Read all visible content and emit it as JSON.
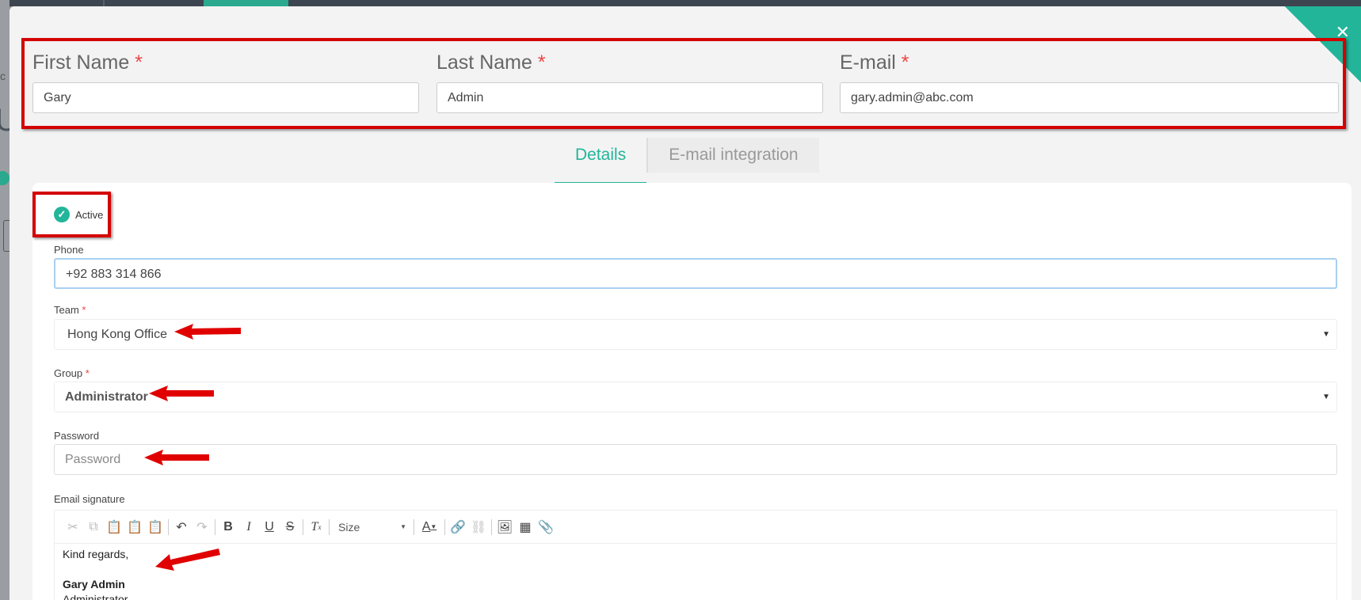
{
  "header": {
    "first_name": {
      "label": "First Name",
      "required_mark": "*",
      "value": "Gary"
    },
    "last_name": {
      "label": "Last Name",
      "required_mark": "*",
      "value": "Admin"
    },
    "email": {
      "label": "E-mail",
      "required_mark": "*",
      "value": "gary.admin@abc.com"
    }
  },
  "tabs": [
    {
      "label": "Details",
      "active": true
    },
    {
      "label": "E-mail integration",
      "active": false
    }
  ],
  "details": {
    "status_label": "Active",
    "phone": {
      "label": "Phone",
      "value": "+92 883 314 866"
    },
    "team": {
      "label": "Team",
      "required_mark": "*",
      "value": "Hong Kong Office"
    },
    "group": {
      "label": "Group",
      "required_mark": "*",
      "value": "Administrator"
    },
    "password": {
      "label": "Password",
      "placeholder": "Password"
    },
    "signature": {
      "label": "Email signature",
      "size_label": "Size",
      "line1": "Kind regards,",
      "name": "Gary Admin",
      "role": "Administrator"
    }
  },
  "icons": {
    "close": "close-icon",
    "check": "check-icon"
  },
  "colors": {
    "accent": "#22b59a",
    "annotation": "#d40000"
  }
}
